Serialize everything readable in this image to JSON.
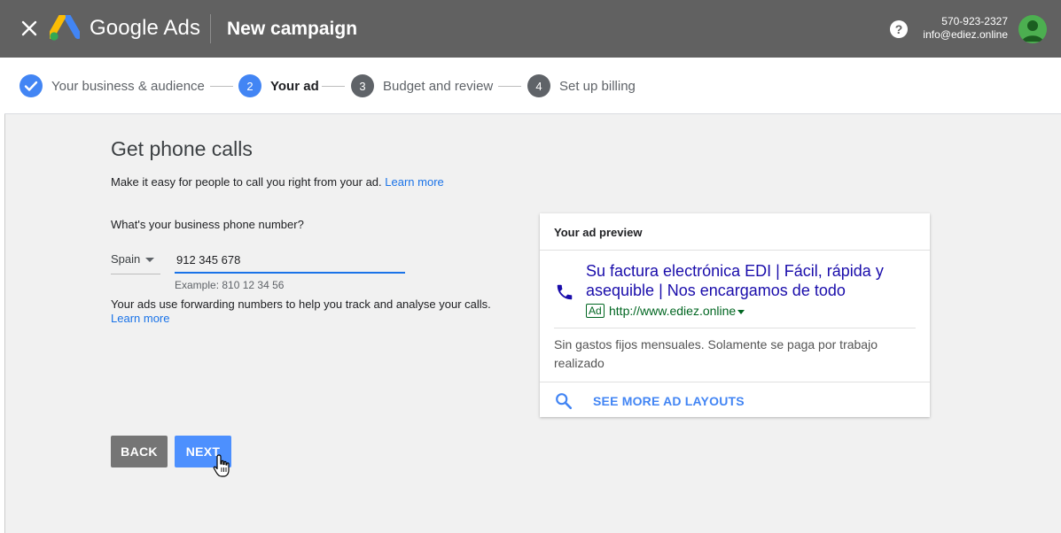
{
  "header": {
    "brand": "Google Ads",
    "page_title": "New campaign",
    "account_phone": "570-923-2327",
    "account_email": "info@ediez.online"
  },
  "stepper": {
    "steps": [
      {
        "number": "",
        "label": "Your business & audience",
        "state": "done"
      },
      {
        "number": "2",
        "label": "Your ad",
        "state": "active"
      },
      {
        "number": "3",
        "label": "Budget and review",
        "state": "pending"
      },
      {
        "number": "4",
        "label": "Set up billing",
        "state": "pending"
      }
    ]
  },
  "main": {
    "heading": "Get phone calls",
    "intro_text": "Make it easy for people to call you right from your ad.",
    "intro_link": "Learn more",
    "phone_question": "What's your business phone number?",
    "country": "Spain",
    "phone_value": "912 345 678",
    "phone_example": "Example: 810 12 34 56",
    "forward_note": "Your ads use forwarding numbers to help you track and analyse your calls.",
    "forward_link": "Learn more",
    "back_label": "BACK",
    "next_label": "NEXT"
  },
  "preview": {
    "title": "Your ad preview",
    "headline": "Su factura electrónica EDI | Fácil, rápida y asequible | Nos encargamos de todo",
    "badge": "Ad",
    "url": "http://www.ediez.online",
    "description": "Sin gastos fijos mensuales. Solamente se paga por trabajo realizado",
    "see_more": "SEE MORE AD LAYOUTS"
  },
  "colors": {
    "topbar": "#616161",
    "accent_blue": "#1a73e8",
    "next_button": "#4d90fe",
    "back_button": "#757575",
    "step_done": "#4285f4",
    "step_pending": "#5f6368",
    "ad_headline": "#1a0dab",
    "ad_url": "#006621"
  }
}
